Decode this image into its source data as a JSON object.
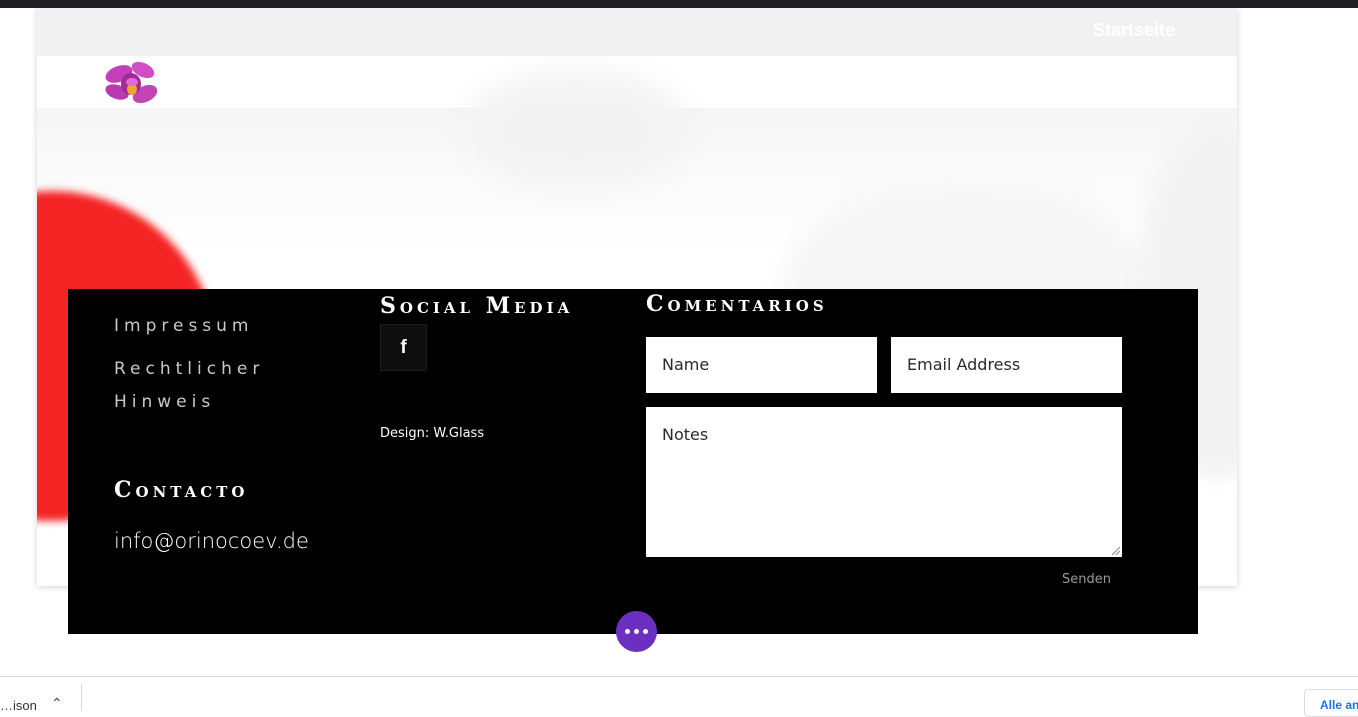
{
  "nav": {
    "home_label": "Startseite"
  },
  "footer": {
    "links": [
      "Impressum",
      "Rechtlicher",
      "Hinweis"
    ],
    "contact_heading": "Contacto",
    "email": "info@orinocoev.de",
    "social_heading": "Social Media",
    "facebook_glyph": "f",
    "design_credit": "Design: W.Glass",
    "comments_heading": "Comentarios",
    "form": {
      "name_placeholder": "Name",
      "email_placeholder": "Email Address",
      "notes_placeholder": "Notes",
      "submit_label": "Senden"
    }
  },
  "downloads": {
    "file_label": "…ison",
    "show_all_label": "Alle an"
  },
  "colors": {
    "footer_bg": "#000000",
    "accent_purple": "#6b2fc1",
    "hero_red": "#f42424"
  },
  "icons": [
    "orchid-logo-icon",
    "facebook-icon",
    "more-dots-icon",
    "chevron-up-icon"
  ]
}
